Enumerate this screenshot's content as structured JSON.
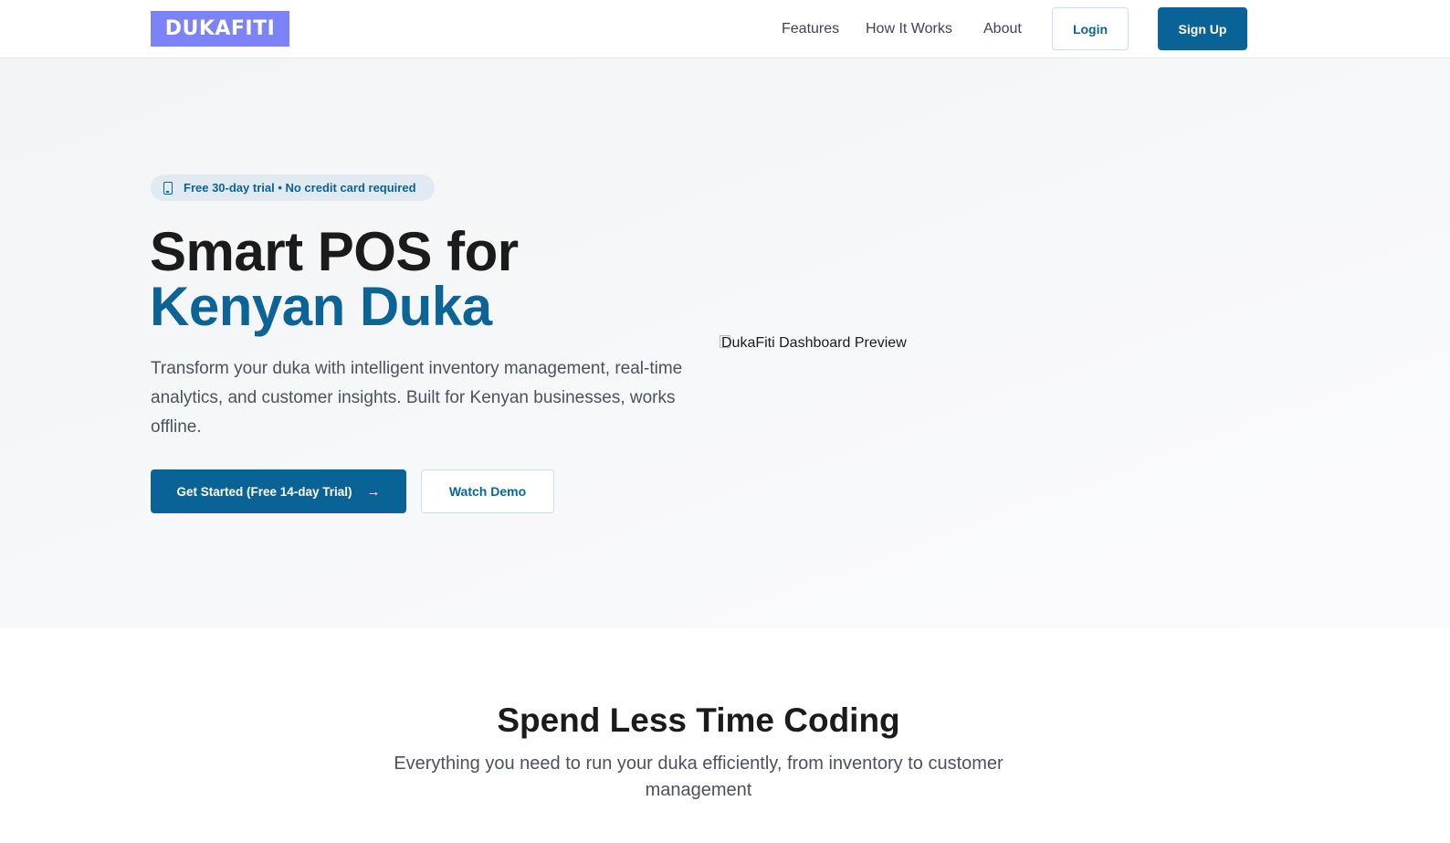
{
  "nav": {
    "logo": "DUKAFITI",
    "links": [
      "Features",
      "How It Works",
      "About"
    ],
    "login": "Login",
    "signup": "Sign Up"
  },
  "hero": {
    "badge": "Free 30-day trial • No credit card required",
    "title_line1": "Smart POS for",
    "title_line2": "Kenyan Duka",
    "description": "Transform your duka with intelligent inventory management, real-time analytics, and customer insights. Built for Kenyan businesses, works offline.",
    "primary_cta": "Get Started (Free 14-day Trial)",
    "secondary_cta": "Watch Demo",
    "preview_alt": "DukaFiti Dashboard Preview"
  },
  "features": {
    "title": "Spend Less Time Coding",
    "description": "Everything you need to run your duka efficiently, from inventory to customer management"
  },
  "colors": {
    "brand": "#0a6396",
    "logo_bg": "#7b83f7",
    "badge_bg": "#e2eaf1"
  },
  "icons": {
    "badge": "phone-icon",
    "primary_cta": "arrow-right-icon"
  }
}
